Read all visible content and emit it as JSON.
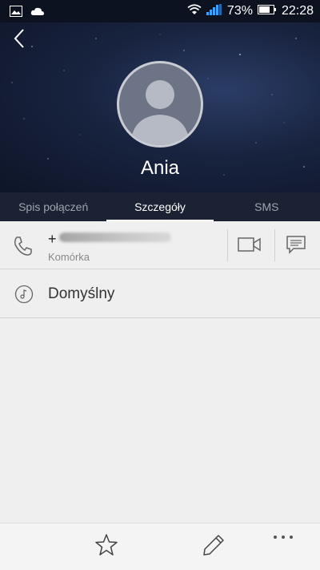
{
  "status_bar": {
    "battery": "73%",
    "time": "22:28",
    "icons": [
      "gallery-icon",
      "cloud-icon",
      "wifi-icon",
      "signal-icon",
      "battery-icon"
    ]
  },
  "header": {
    "back_icon": "back-arrow-icon",
    "avatar_icon": "default-avatar-icon",
    "contact_name": "Ania"
  },
  "tabs": [
    {
      "label": "Spis połączeń",
      "active": false
    },
    {
      "label": "Szczegóły",
      "active": true
    },
    {
      "label": "SMS",
      "active": false
    }
  ],
  "phone": {
    "number_prefix": "+",
    "type": "Komórka",
    "call_icon": "phone-icon",
    "video_icon": "video-call-icon",
    "message_icon": "message-icon"
  },
  "ringtone": {
    "label": "Domyślny",
    "icon": "music-note-icon"
  },
  "bottom_bar": {
    "icons": [
      "star-icon",
      "pencil-icon",
      "more-icon"
    ]
  },
  "colors": {
    "header_dark": "#0e1528",
    "tab_bar": "#1b2233",
    "background": "#efefef"
  }
}
